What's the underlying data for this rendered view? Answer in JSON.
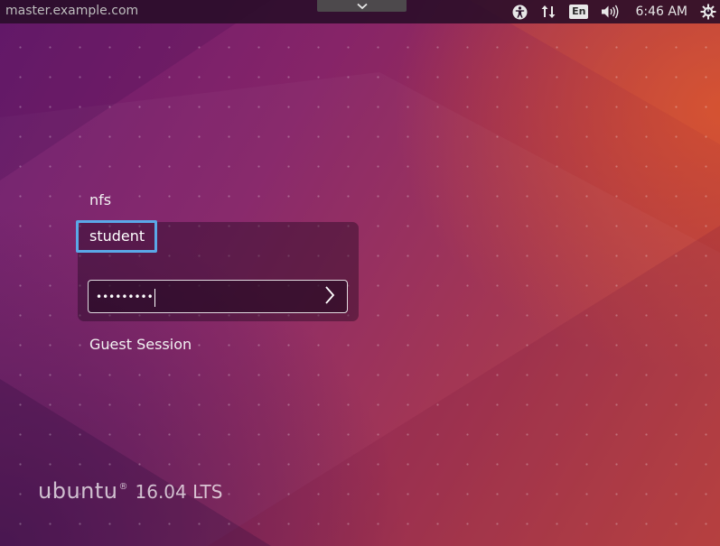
{
  "top_panel": {
    "hostname": "master.example.com",
    "language": "En",
    "clock": "6:46 AM",
    "icons": [
      "accessibility-icon",
      "network-icon",
      "keyboard-language-icon",
      "volume-icon",
      "power-gear-icon",
      "chevron-down-icon"
    ]
  },
  "users": {
    "nfs": "nfs",
    "student": "student",
    "guest": "Guest Session"
  },
  "login": {
    "password_mask": "•••••••••"
  },
  "branding": {
    "word": "ubuntu",
    "reg_mark": "®",
    "version": "16.04 LTS"
  },
  "colors": {
    "selection_border": "#5aa8e8",
    "panel_bg": "#280c28",
    "accent_orange": "#c2453a",
    "accent_purple": "#6b1c6e"
  }
}
